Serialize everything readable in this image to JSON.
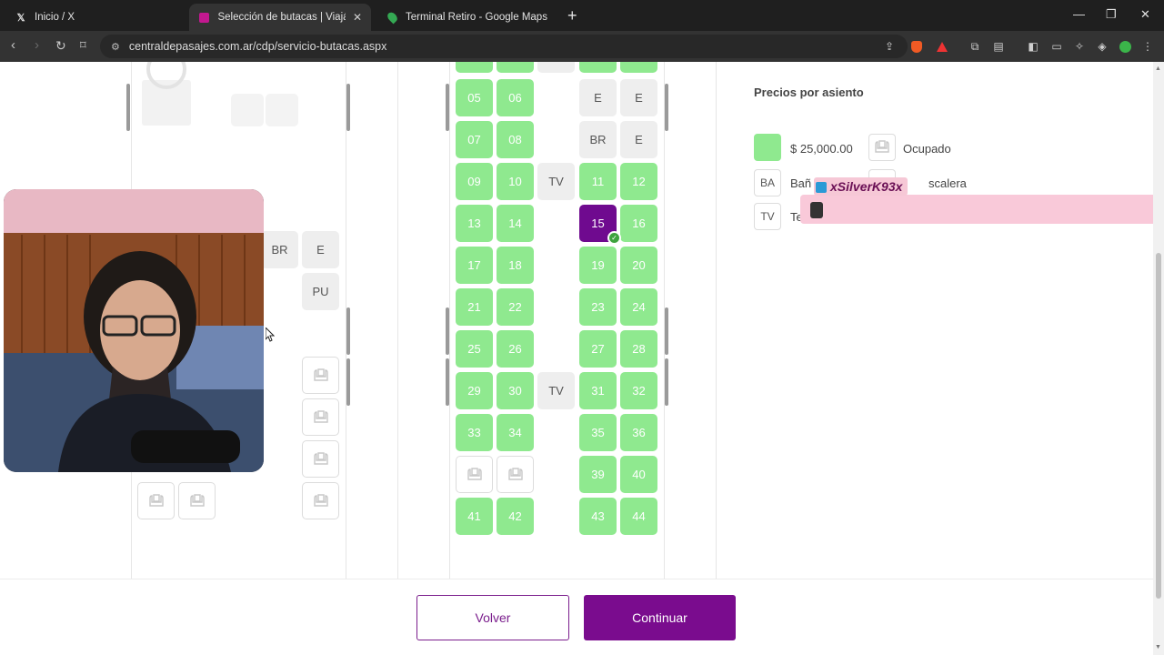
{
  "browser": {
    "tabs": [
      {
        "label": "Inicio / X",
        "favicon": "X"
      },
      {
        "label": "Selección de butacas | Viajá en b",
        "favicon": "bus"
      },
      {
        "label": "Terminal Retiro - Google Maps",
        "favicon": "map-pin"
      }
    ],
    "url": "centraldepasajes.com.ar/cdp/servicio-butacas.aspx"
  },
  "lower_deck": {
    "utility": {
      "br": "BR",
      "e": "E",
      "pu": "PU"
    }
  },
  "upper_deck": {
    "rows": [
      {
        "left": [
          "05",
          "06"
        ],
        "aisle": "",
        "right": [
          "E",
          "E"
        ]
      },
      {
        "left": [
          "07",
          "08"
        ],
        "aisle": "",
        "right": [
          "BR",
          "E"
        ]
      },
      {
        "left": [
          "09",
          "10"
        ],
        "aisle": "TV",
        "right": [
          "11",
          "12"
        ]
      },
      {
        "left": [
          "13",
          "14"
        ],
        "aisle": "",
        "right": [
          "15",
          "16"
        ]
      },
      {
        "left": [
          "17",
          "18"
        ],
        "aisle": "",
        "right": [
          "19",
          "20"
        ]
      },
      {
        "left": [
          "21",
          "22"
        ],
        "aisle": "",
        "right": [
          "23",
          "24"
        ]
      },
      {
        "left": [
          "25",
          "26"
        ],
        "aisle": "",
        "right": [
          "27",
          "28"
        ]
      },
      {
        "left": [
          "29",
          "30"
        ],
        "aisle": "TV",
        "right": [
          "31",
          "32"
        ]
      },
      {
        "left": [
          "33",
          "34"
        ],
        "aisle": "",
        "right": [
          "35",
          "36"
        ]
      },
      {
        "left": [
          "",
          ""
        ],
        "aisle": "",
        "right": [
          "39",
          "40"
        ]
      },
      {
        "left": [
          "41",
          "42"
        ],
        "aisle": "",
        "right": [
          "43",
          "44"
        ]
      }
    ],
    "selected_seat": "15"
  },
  "legend": {
    "title": "Precios por asiento",
    "price": "$ 25,000.00",
    "occupied": "Ocupado",
    "ba_code": "BA",
    "ba_label": "Bañ",
    "stairs_label": "scalera",
    "tv_code": "TV",
    "tv_label": "Te"
  },
  "overlay": {
    "chat_user": "xSilverK93x"
  },
  "footer": {
    "back": "Volver",
    "continue": "Continuar"
  },
  "colors": {
    "seat_free": "#8fe98f",
    "seat_selected": "#6f0a8f",
    "brand": "#7a0c8e"
  }
}
